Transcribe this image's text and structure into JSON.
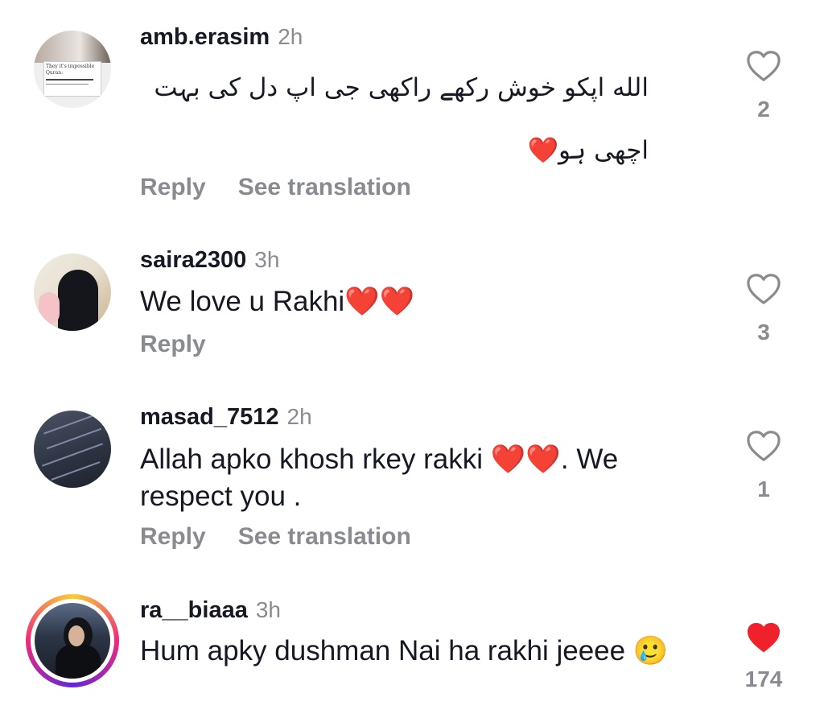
{
  "comments": [
    {
      "username": "amb.erasim",
      "time": "2h",
      "text_line1": "الله اپکو خوش رکھے راکھی جی اپ دل کی بہت",
      "text_line2": "اچھی ہو❤️",
      "actions": [
        "Reply",
        "See translation"
      ],
      "likes": "2",
      "liked": false,
      "avatar": {
        "caption": "They it's impossible",
        "sub": "Quran:"
      }
    },
    {
      "username": "saira2300",
      "time": "3h",
      "text": "We love u Rakhi❤️❤️",
      "actions": [
        "Reply"
      ],
      "likes": "3",
      "liked": false
    },
    {
      "username": "masad_7512",
      "time": "2h",
      "text": "Allah apko khosh rkey rakki ❤️❤️. We respect you .",
      "actions": [
        "Reply",
        "See translation"
      ],
      "likes": "1",
      "liked": false
    },
    {
      "username": "ra__biaaa",
      "time": "3h",
      "text": "Hum apky dushman Nai ha rakhi jeeee 🥲",
      "likes": "174",
      "liked": true
    }
  ],
  "colors": {
    "like_active": "#f0212b",
    "muted": "#8a8b91",
    "text": "#161823"
  }
}
